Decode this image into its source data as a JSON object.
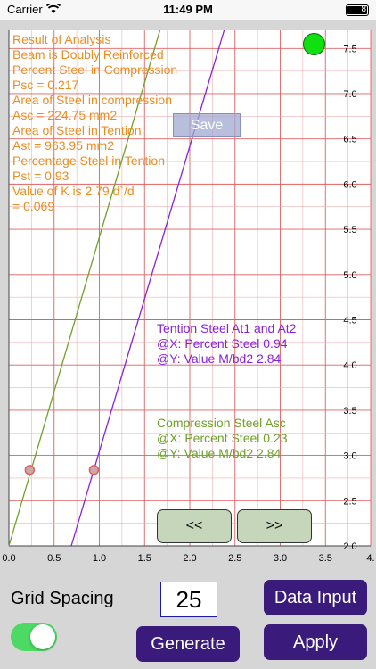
{
  "status": {
    "carrier": "Carrier",
    "time": "11:49 PM",
    "battery": "8"
  },
  "analysis": [
    "Result of Analysis",
    "Beam is Doubly Reinforced",
    "Percent Steel in Compression",
    "Psc = 0.217",
    "Area of Steel in compression",
    "Asc = 224.75 mm2",
    "Area of Steel in Tention",
    "Ast = 963.95 mm2",
    "Percentage Steel in Tention",
    "Pst = 0.93",
    "Value of K is 2.79 d`/d",
    "= 0.069"
  ],
  "save_label": "Save",
  "tention": [
    "Tention Steel At1 and At2",
    "@X: Percent Steel 0.94",
    "@Y: Value M/bd2 2.84"
  ],
  "compression": [
    "Compression Steel Asc",
    "@X: Percent Steel 0.23",
    "@Y: Value M/bd2 2.84"
  ],
  "nav": {
    "prev": "<<",
    "next": ">>"
  },
  "controls": {
    "grid_spacing_label": "Grid Spacing",
    "grid_spacing_value": "25",
    "data_input": "Data Input",
    "generate": "Generate",
    "apply": "Apply",
    "toggle_on": true
  },
  "chart_data": {
    "type": "line",
    "xlim": [
      0,
      4.0
    ],
    "ylim": [
      2.0,
      7.7
    ],
    "x_ticks": [
      "0.0",
      "0.5",
      "1.0",
      "1.5",
      "2.0",
      "2.5",
      "3.0",
      "3.5",
      "4."
    ],
    "y_ticks": [
      "2.0",
      "2.5",
      "3.0",
      "3.5",
      "4.0",
      "4.5",
      "5.0",
      "5.5",
      "6.0",
      "6.5",
      "7.0",
      "7.5"
    ],
    "grid": true,
    "series": [
      {
        "color": "#6fa02a",
        "x": [
          0.0,
          1.67
        ],
        "y": [
          2.0,
          7.7
        ]
      },
      {
        "color": "#8a1ee0",
        "x": [
          0.69,
          2.38
        ],
        "y": [
          2.0,
          7.7
        ]
      }
    ],
    "points": [
      {
        "x": 0.23,
        "y": 2.84
      },
      {
        "x": 0.94,
        "y": 2.84
      }
    ],
    "colors": {
      "grid_major": "#e06060",
      "grid_minor": "#f0b0b0",
      "point": "#e06060"
    }
  }
}
